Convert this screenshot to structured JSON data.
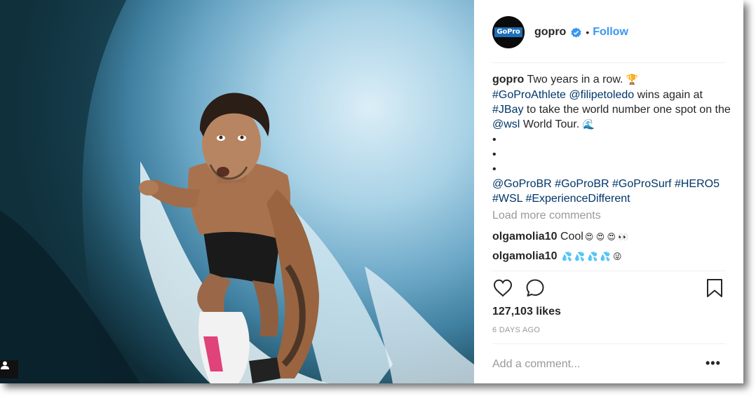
{
  "post": {
    "username": "gopro",
    "follow_label": "Follow",
    "separator": "•",
    "avatar_logo": "GoPro",
    "caption": {
      "username": "gopro",
      "line1_text": "Two years in a row.",
      "hashtag1": "#GoProAthlete",
      "mention1": "@filipetoledo",
      "text2": "wins again at",
      "hashtag2": "#JBay",
      "text3": "to take the world number one spot on the",
      "mention2": "@wsl",
      "text4": "World Tour.",
      "bullets": [
        "•",
        "•",
        "•"
      ],
      "tags_line1": [
        "@GoProBR",
        "#GoProBR",
        "#GoProSurf",
        "#HERO5"
      ],
      "tags_line2": [
        "#WSL",
        "#ExperienceDifferent"
      ]
    },
    "load_more_label": "Load more comments",
    "comments": [
      {
        "username": "olgamolia10",
        "text": "Cool",
        "emojis": "😍 😍 😍 👀"
      },
      {
        "username": "olgamolia10",
        "text": "",
        "emojis": "💦 💦 💦 💦 😜"
      }
    ],
    "likes_label": "127,103 likes",
    "time_label": "6 DAYS AGO",
    "add_comment_placeholder": "Add a comment...",
    "more_label": "•••"
  },
  "colors": {
    "link": "#003569",
    "follow": "#3897f0",
    "muted": "#999999",
    "text": "#262626"
  },
  "icons": [
    "verified-badge-icon",
    "trophy-icon",
    "wave-icon",
    "heart-icon",
    "comment-icon",
    "bookmark-icon",
    "user-tag-icon"
  ]
}
